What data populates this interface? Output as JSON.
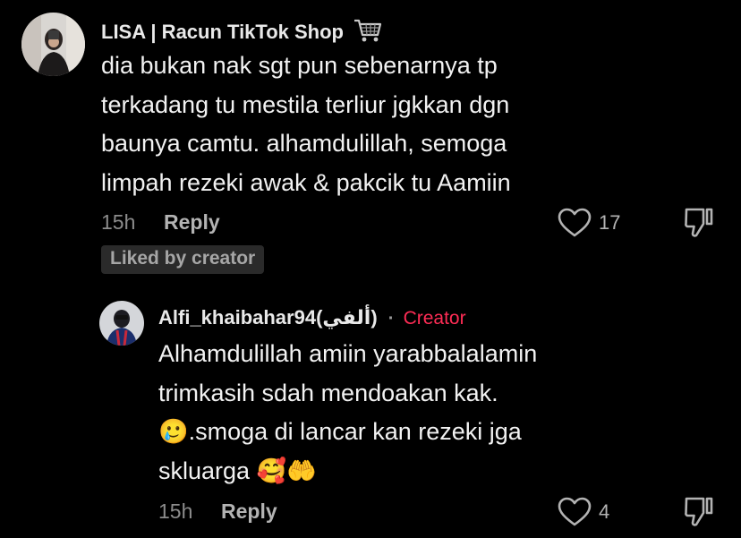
{
  "comment": {
    "username": "LISA | Racun TikTok Shop",
    "username_emoji": "🛒",
    "lines": [
      "dia bukan nak sgt pun sebenarnya tp",
      "terkadang tu mestila terliur jgkkan dgn",
      "baunya camtu. alhamdulillah, semoga",
      "limpah rezeki awak & pakcik tu Aamiin"
    ],
    "time": "15h",
    "reply_label": "Reply",
    "like_count": "17",
    "liked_badge": "Liked by creator"
  },
  "reply": {
    "username": "Alfi_khaibahar94(ألفي)",
    "separator": "·",
    "creator_label": "Creator",
    "lines": [
      "Alhamdulillah amiin yarabbalalamin",
      "trimkasih sdah mendoakan kak.",
      "🥲.smoga di lancar kan rezeki jga",
      "skluarga 🥰🤲"
    ],
    "time": "15h",
    "reply_label": "Reply",
    "like_count": "4"
  },
  "colors": {
    "background": "#000000",
    "text": "#f2f2f2",
    "muted": "#8c8c8c",
    "creator": "#fe2c55"
  },
  "icons": [
    "avatar-lisa",
    "avatar-alfi",
    "cart-icon",
    "heart-icon",
    "dislike-icon"
  ]
}
